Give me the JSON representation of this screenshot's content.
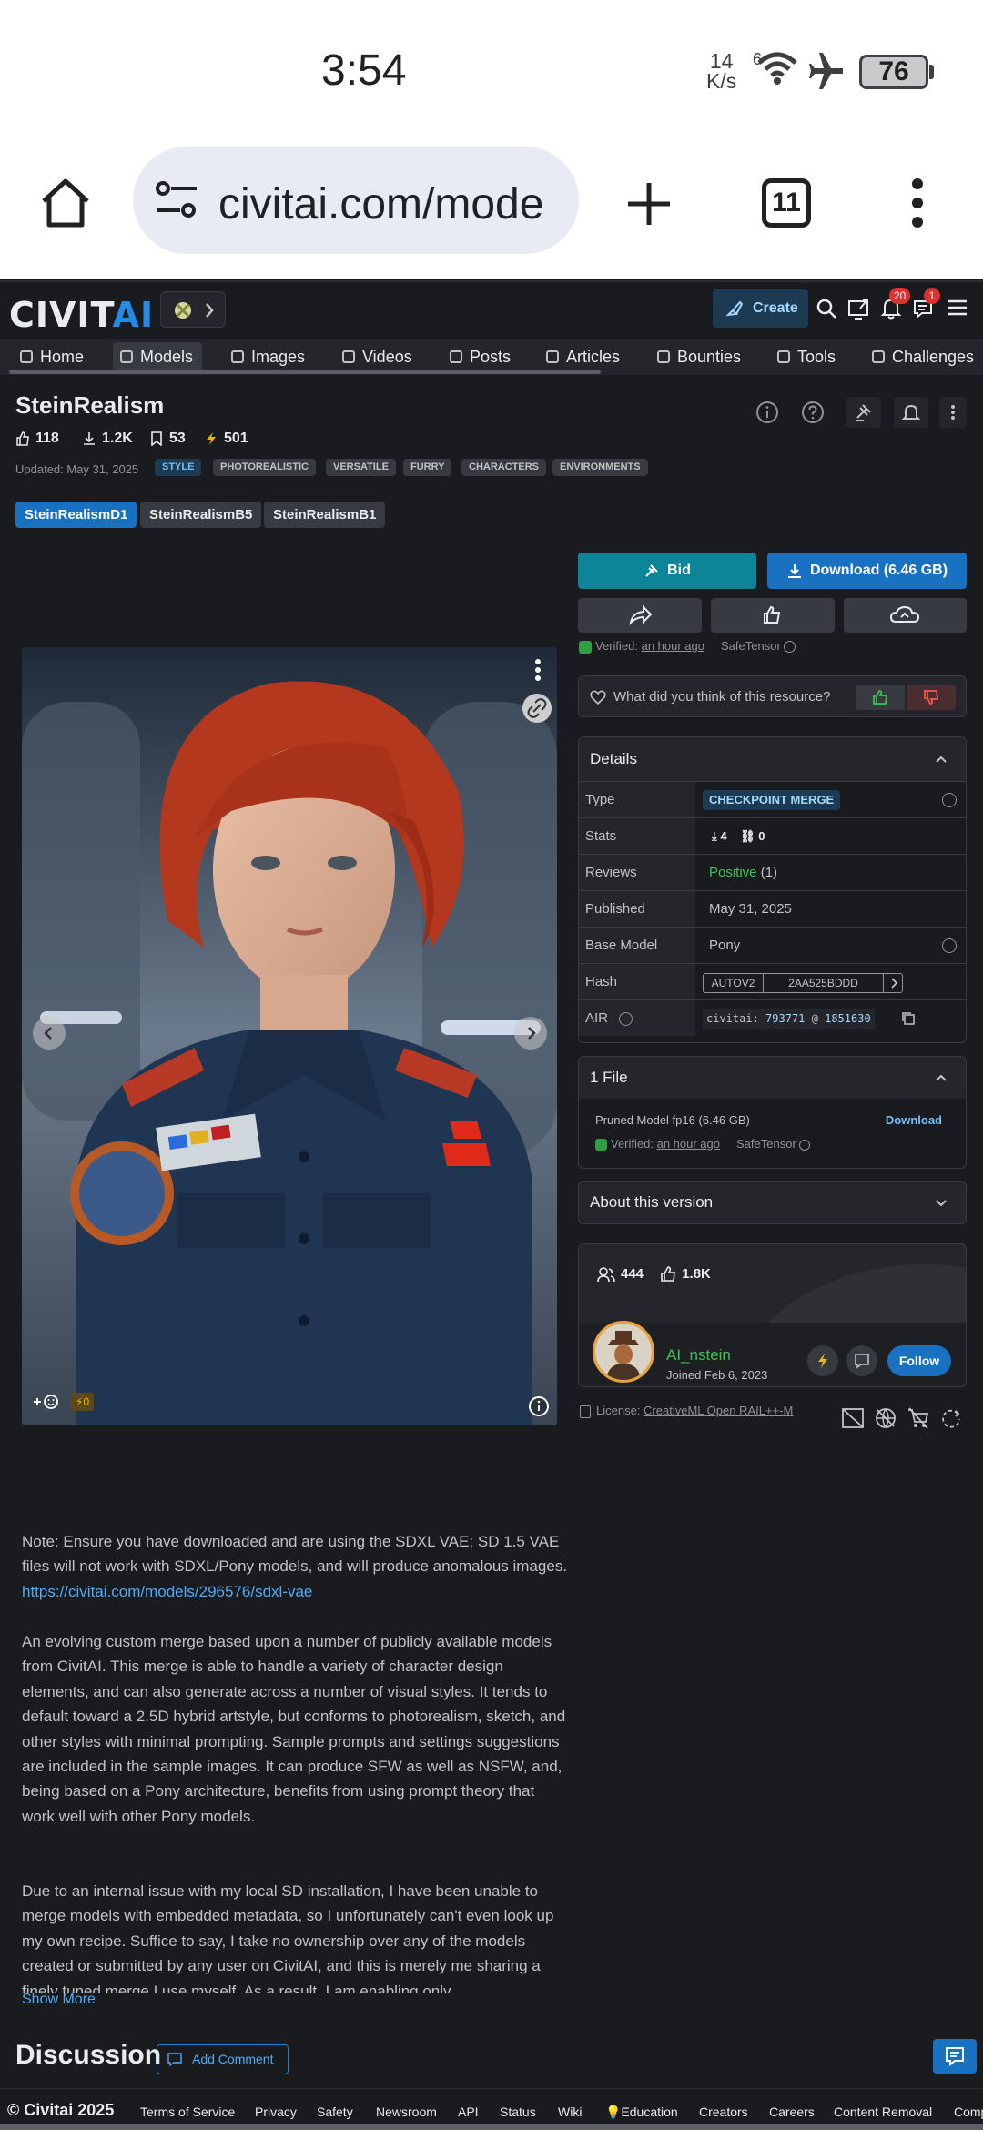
{
  "status_bar": {
    "time": "3:54",
    "net_speed_value": "14",
    "net_speed_unit": "K/s",
    "wifi_label": "6",
    "battery": "76"
  },
  "browser": {
    "url": "civitai.com/mode",
    "tab_count": "11"
  },
  "header": {
    "logo_main": "CIVIT",
    "logo_accent": "AI",
    "create_label": "Create",
    "notification_count": "20",
    "chat_count": "1"
  },
  "nav": {
    "items": [
      "Home",
      "Models",
      "Images",
      "Videos",
      "Posts",
      "Articles",
      "Bounties",
      "Tools",
      "Challenges"
    ],
    "active": "Models"
  },
  "model": {
    "title": "SteinRealism",
    "likes": "118",
    "downloads": "1.2K",
    "bookmarks": "53",
    "buzz": "501",
    "updated": "Updated: May 31, 2025",
    "tags": [
      "STYLE",
      "PHOTOREALISTIC",
      "VERSATILE",
      "FURRY",
      "CHARACTERS",
      "ENVIRONMENTS"
    ],
    "versions": [
      "SteinRealismD1",
      "SteinRealismB5",
      "SteinRealismB1"
    ],
    "active_version": "SteinRealismD1"
  },
  "actions": {
    "bid_label": "Bid",
    "download_label": "Download (6.46 GB)",
    "verified_label": "Verified:",
    "verified_time": "an hour ago",
    "safetensor": "SafeTensor",
    "feedback_question": "What did you think of this resource?"
  },
  "details": {
    "heading": "Details",
    "rows": {
      "type_key": "Type",
      "type_val": "CHECKPOINT MERGE",
      "stats_key": "Stats",
      "stats_downloads": "4",
      "stats_generations": "0",
      "reviews_key": "Reviews",
      "reviews_val": "Positive",
      "reviews_count": "(1)",
      "published_key": "Published",
      "published_val": "May 31, 2025",
      "base_key": "Base Model",
      "base_val": "Pony",
      "hash_key": "Hash",
      "hash_algo": "AUTOV2",
      "hash_val": "2AA525BDDD",
      "air_key": "AIR",
      "air_prefix": "civitai:",
      "air_model": "793771",
      "air_at": "@",
      "air_version": "1851630"
    }
  },
  "files": {
    "heading": "1 File",
    "name": "Pruned Model fp16 (6.46 GB)",
    "download": "Download",
    "verified_label": "Verified:",
    "verified_time": "an hour ago",
    "safetensor": "SafeTensor"
  },
  "about": {
    "heading": "About this version"
  },
  "creator": {
    "followers": "444",
    "likes": "1.8K",
    "name": "AI_nstein",
    "joined": "Joined Feb 6, 2023",
    "follow_label": "Follow"
  },
  "license": {
    "label": "License:",
    "name": "CreativeML Open RAIL++-M"
  },
  "image": {
    "reactions_buzz": "0"
  },
  "description": {
    "p1_text": "Note: Ensure you have downloaded and are using the SDXL VAE; SD 1.5 VAE files will not work with SDXL/Pony models, and will produce anomalous images. ",
    "p1_link": "https://civitai.com/models/296576/sdxl-vae",
    "p2": "An evolving custom merge based upon a number of publicly available models from CivitAI. This merge is able to handle a variety of character design elements, and can also generate across a number of visual styles. It tends to default toward a 2.5D hybrid artstyle, but conforms to photorealism, sketch, and other styles with minimal prompting. Sample prompts and settings suggestions are included in the sample images. It can produce SFW as well as NSFW, and, being based on a Pony architecture, benefits from using prompt theory that work well with other Pony models.",
    "p3": "Due to an internal issue with my local SD installation, I have been unable to merge models with embedded metadata, so I unfortunately can't even look up my own recipe. Suffice to say, I take no ownership over any of the models created or submitted by any user on CivitAI, and this is merely me sharing a finely tuned merge I use myself. As a result, I am enabling only",
    "show_more": "Show More"
  },
  "discussion": {
    "heading": "Discussion",
    "add_comment": "Add Comment"
  },
  "footer": {
    "copyright": "© Civitai 2025",
    "links": [
      "Terms of Service",
      "Privacy",
      "Safety",
      "Newsroom",
      "API",
      "Status",
      "Wiki",
      "💡Education",
      "Creators",
      "Careers",
      "Content Removal",
      "Comp"
    ]
  },
  "colors": {
    "background": "#1a1b1e",
    "accent_blue": "#1971c2",
    "accent_teal": "#0c8599",
    "positive": "#40c057"
  }
}
